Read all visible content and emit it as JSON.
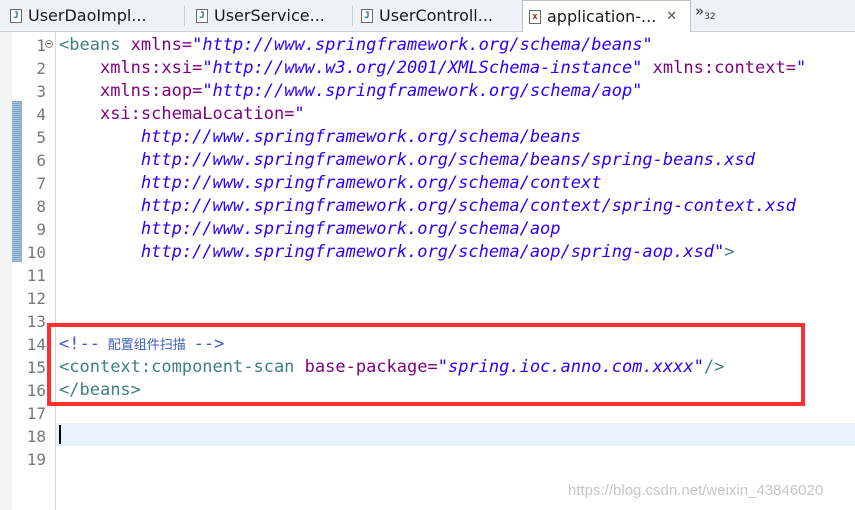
{
  "tabs": [
    {
      "label": "UserDaoImpl...",
      "type": "java",
      "active": false
    },
    {
      "label": "UserService...",
      "type": "java",
      "active": false
    },
    {
      "label": "UserControll...",
      "type": "java",
      "active": false
    },
    {
      "label": "application-...",
      "type": "xml",
      "active": true
    }
  ],
  "tab_close_glyph": "✕",
  "tab_overflow": {
    "glyph": "»",
    "count": "32"
  },
  "editor": {
    "line_numbers": [
      "1",
      "2",
      "3",
      "4",
      "5",
      "6",
      "7",
      "8",
      "9",
      "10",
      "11",
      "12",
      "13",
      "14",
      "15",
      "16",
      "17",
      "18",
      "19"
    ],
    "lines": {
      "l1": {
        "open": "<",
        "tag": "beans",
        "attr": " xmlns=",
        "value": "\"http://www.springframework.org/schema/beans\""
      },
      "l2": {
        "attr": "xmlns:xsi=",
        "value": "\"http://www.w3.org/2001/XMLSchema-instance\"",
        "attr2": " xmlns:context=",
        "value2": "\""
      },
      "l3": {
        "attr": "xmlns:aop=",
        "value": "\"http://www.springframework.org/schema/aop\""
      },
      "l4": {
        "attr": "xsi:schemaLocation=",
        "value": "\""
      },
      "l5": "http://www.springframework.org/schema/beans",
      "l6": "http://www.springframework.org/schema/beans/spring-beans.xsd",
      "l7": "http://www.springframework.org/schema/context",
      "l8": "http://www.springframework.org/schema/context/spring-context.xsd",
      "l9": "http://www.springframework.org/schema/aop",
      "l10": {
        "value": "http://www.springframework.org/schema/aop/spring-aop.xsd\"",
        "close": ">"
      },
      "l14": {
        "open": "<!--",
        "text": " 配置组件扫描 ",
        "close": "-->"
      },
      "l15": {
        "open": "<",
        "tag": "context:component-scan",
        "attr": " base-package=",
        "value": "\"spring.ioc.anno.com.xxxx\"",
        "close": "/>"
      },
      "l16": {
        "open": "</",
        "tag": "beans",
        "close": ">"
      }
    }
  },
  "watermark": "https://blog.csdn.net/weixin_43846020",
  "colors": {
    "tag": "#3f7f7f",
    "attribute": "#7f007f",
    "string": "#2a00ff",
    "comment": "#3f5fbf",
    "highlight_box": "#ff2f2f",
    "current_line": "#e8f2fe"
  }
}
